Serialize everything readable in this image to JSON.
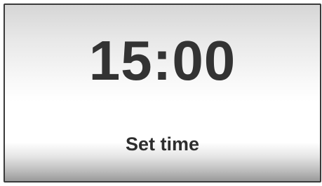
{
  "display": {
    "time": "15:00",
    "caption": "Set time"
  }
}
